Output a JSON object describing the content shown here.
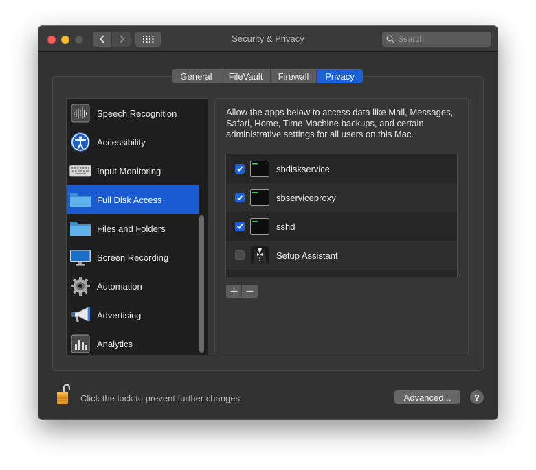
{
  "window": {
    "title": "Security & Privacy"
  },
  "toolbar": {
    "search_placeholder": "Search"
  },
  "tabs": [
    {
      "label": "General"
    },
    {
      "label": "FileVault"
    },
    {
      "label": "Firewall"
    },
    {
      "label": "Privacy",
      "active": true
    }
  ],
  "sidebar": {
    "items": [
      {
        "label": "Speech Recognition",
        "icon": "waveform-icon"
      },
      {
        "label": "Accessibility",
        "icon": "accessibility-icon"
      },
      {
        "label": "Input Monitoring",
        "icon": "keyboard-icon"
      },
      {
        "label": "Full Disk Access",
        "icon": "folder-icon",
        "selected": true
      },
      {
        "label": "Files and Folders",
        "icon": "folder-icon"
      },
      {
        "label": "Screen Recording",
        "icon": "display-icon"
      },
      {
        "label": "Automation",
        "icon": "gear-icon"
      },
      {
        "label": "Advertising",
        "icon": "megaphone-icon"
      },
      {
        "label": "Analytics",
        "icon": "chart-icon"
      }
    ]
  },
  "main": {
    "description": "Allow the apps below to access data like Mail, Messages, Safari, Home, Time Machine backups, and certain administrative settings for all users on this Mac.",
    "apps": [
      {
        "name": "sbdiskservice",
        "checked": true,
        "icon": "terminal-icon"
      },
      {
        "name": "sbserviceproxy",
        "checked": true,
        "icon": "terminal-icon"
      },
      {
        "name": "sshd",
        "checked": true,
        "icon": "terminal-icon"
      },
      {
        "name": "Setup Assistant",
        "checked": false,
        "icon": "tuxedo-icon"
      }
    ]
  },
  "footer": {
    "lock_message": "Click the lock to prevent further changes.",
    "advanced_label": "Advanced...",
    "help_label": "?"
  },
  "colors": {
    "accent": "#1a60d6",
    "window_bg": "#323232"
  }
}
